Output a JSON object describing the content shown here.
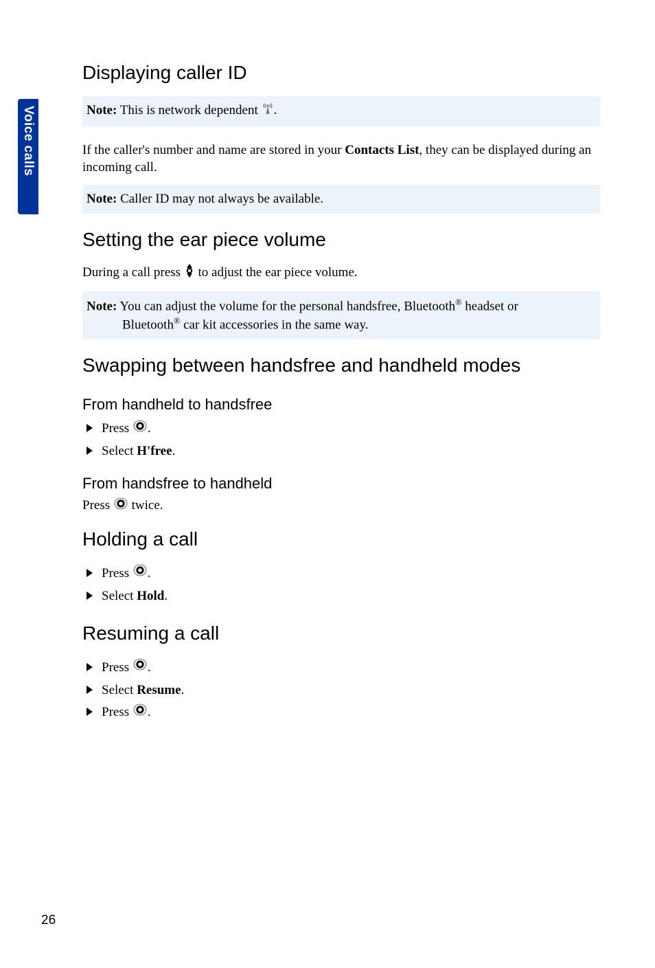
{
  "sidebar": {
    "label": "Voice calls"
  },
  "page_number": "26",
  "sections": {
    "display_caller_id": {
      "heading": "Displaying caller ID",
      "note1_label": "Note:",
      "note1_text": " This is network dependent ",
      "note1_trail": ".",
      "body_before": "If the caller's number and name are stored in your ",
      "body_bold": "Contacts List",
      "body_after": ", they can be displayed during an incoming call.",
      "note2_label": "Note:",
      "note2_text": " Caller ID may not always be available."
    },
    "earpiece_volume": {
      "heading": "Setting the ear piece volume",
      "line_before": "During a call press ",
      "line_after": " to adjust the ear piece volume.",
      "note_label": "Note:",
      "note_line1_before": " You can adjust the volume for the personal handsfree, Bluetooth",
      "note_line1_after": " headset or",
      "note_line2_before": "Bluetooth",
      "note_line2_after": " car kit accessories in the same way.",
      "reg": "®"
    },
    "swap_modes": {
      "heading": "Swapping between handsfree and handheld modes",
      "sub1": "From handheld to handsfree",
      "s1_press": "Press ",
      "s1_dot": ".",
      "s1_select_before": "Select ",
      "s1_select_bold": "H'free",
      "s1_select_after": ".",
      "sub2": "From handsfree to handheld",
      "sub2_line_before": "Press ",
      "sub2_line_after": " twice."
    },
    "holding": {
      "heading": "Holding a call",
      "press": "Press ",
      "dot": ".",
      "select_before": "Select ",
      "select_bold": "Hold",
      "select_after": "."
    },
    "resuming": {
      "heading": "Resuming a call",
      "press": "Press ",
      "dot": ".",
      "select_before": "Select ",
      "select_bold": "Resume",
      "select_after": "."
    }
  }
}
